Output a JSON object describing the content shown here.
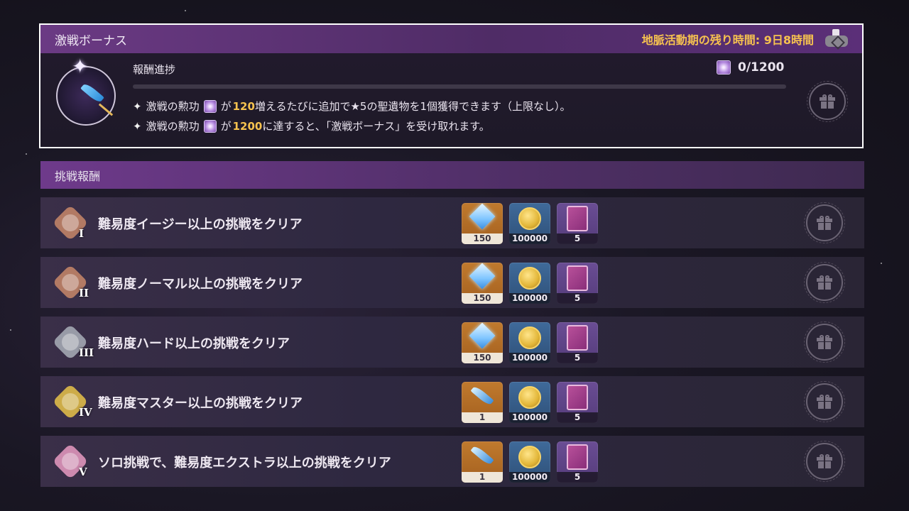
{
  "bonus": {
    "title": "激戦ボーナス",
    "timer": "地脈活動期の残り時間: 9日8時間",
    "progress_label": "報酬進捗",
    "progress_count": "0/1200",
    "progress_fraction": 0,
    "rule1": {
      "prefix": "激戦の勲功",
      "mid": "が",
      "number": "120",
      "suffix": "増えるたびに追加で★5の聖遺物を1個獲得できます（上限なし）。"
    },
    "rule2": {
      "prefix": "激戦の勲功",
      "mid": "が",
      "number": "1200",
      "suffix": "に達すると、「激戦ボーナス」を受け取れます。"
    }
  },
  "challenge": {
    "title": "挑戦報酬",
    "rows": [
      {
        "numeral": "I",
        "label": "難易度イージー以上の挑戦をクリア",
        "badge_color": "#c8876a",
        "items": [
          {
            "icon": "primogem-icon",
            "count": "150"
          },
          {
            "icon": "mora-icon",
            "count": "100000"
          },
          {
            "icon": "book-icon",
            "count": "5"
          }
        ]
      },
      {
        "numeral": "II",
        "label": "難易度ノーマル以上の挑戦をクリア",
        "badge_color": "#c8876a",
        "items": [
          {
            "icon": "primogem-icon",
            "count": "150"
          },
          {
            "icon": "mora-icon",
            "count": "100000"
          },
          {
            "icon": "book-icon",
            "count": "5"
          }
        ]
      },
      {
        "numeral": "III",
        "label": "難易度ハード以上の挑戦をクリア",
        "badge_color": "#a9aeb8",
        "items": [
          {
            "icon": "primogem-icon",
            "count": "150"
          },
          {
            "icon": "mora-icon",
            "count": "100000"
          },
          {
            "icon": "book-icon",
            "count": "5"
          }
        ]
      },
      {
        "numeral": "IV",
        "label": "難易度マスター以上の挑戦をクリア",
        "badge_color": "#e8c24a",
        "items": [
          {
            "icon": "quill-icon",
            "count": "1"
          },
          {
            "icon": "mora-icon",
            "count": "100000"
          },
          {
            "icon": "book-icon",
            "count": "5"
          }
        ]
      },
      {
        "numeral": "V",
        "label": "ソロ挑戦で、難易度エクストラ以上の挑戦をクリア",
        "badge_color": "#e79ac2",
        "items": [
          {
            "icon": "quill-icon",
            "count": "1"
          },
          {
            "icon": "mora-icon",
            "count": "100000"
          },
          {
            "icon": "book-icon",
            "count": "5"
          }
        ]
      }
    ]
  },
  "colors": {
    "highlight": "#f6c24f",
    "header_purple": "#6b3a84"
  }
}
